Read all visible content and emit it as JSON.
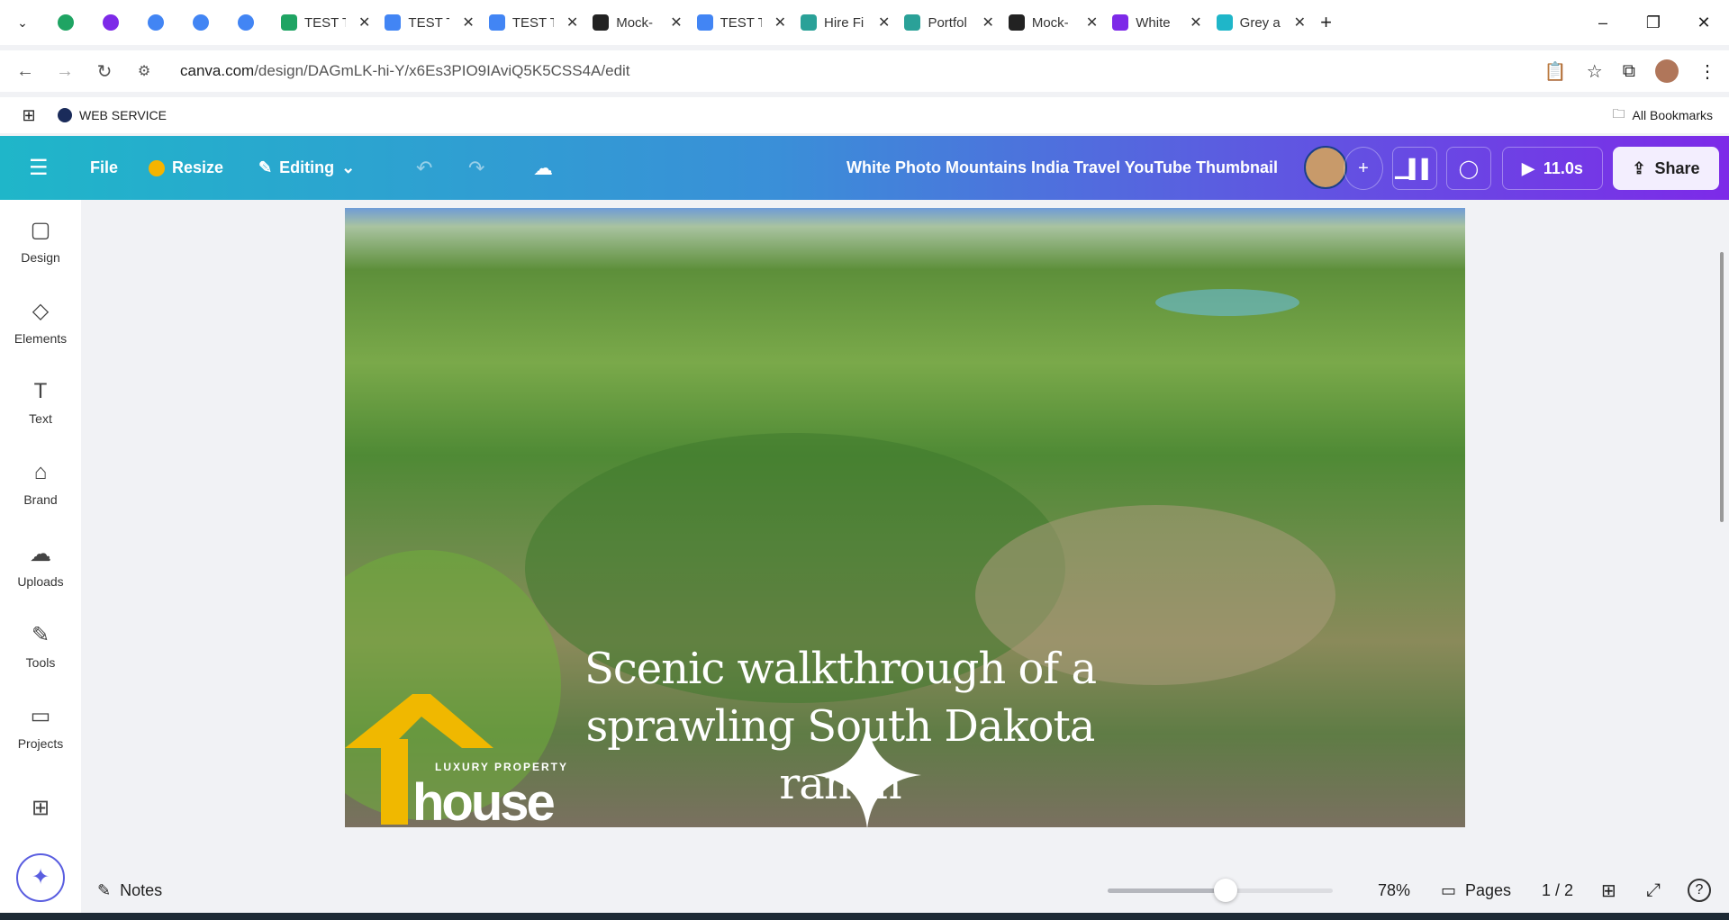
{
  "browser": {
    "tabs": [
      {
        "label": "",
        "color": "#1fa463"
      },
      {
        "label": "",
        "color": "#7d2ae8"
      },
      {
        "label": "",
        "color": "#4285f4"
      },
      {
        "label": "",
        "color": "#4285f4"
      },
      {
        "label": "",
        "color": "#4285f4"
      },
      {
        "label": "TEST T",
        "color": "#1fa463"
      },
      {
        "label": "TEST T",
        "color": "#4285f4"
      },
      {
        "label": "TEST T",
        "color": "#4285f4"
      },
      {
        "label": "Mock-",
        "color": "#222"
      },
      {
        "label": "TEST T",
        "color": "#4285f4"
      },
      {
        "label": "Hire Fi",
        "color": "#2aa198"
      },
      {
        "label": "Portfol",
        "color": "#2aa198"
      },
      {
        "label": "Mock-",
        "color": "#222"
      },
      {
        "label": "White",
        "color": "#7d2ae8"
      },
      {
        "label": "Grey a",
        "color": "#1fb6c9"
      }
    ],
    "url_host": "canva.com",
    "url_path": "/design/DAGmLK-hi-Y/x6Es3PIO9IAviQ5K5CSS4A/edit",
    "bookmark": "WEB SERVICE",
    "all_bookmarks": "All Bookmarks"
  },
  "toolbar": {
    "file": "File",
    "resize": "Resize",
    "editing": "Editing",
    "title": "White Photo Mountains India Travel YouTube Thumbnail",
    "duration": "11.0s",
    "share": "Share"
  },
  "sidebar": [
    {
      "label": "Design",
      "icon": "▢"
    },
    {
      "label": "Elements",
      "icon": "◇"
    },
    {
      "label": "Text",
      "icon": "T"
    },
    {
      "label": "Brand",
      "icon": "⌂"
    },
    {
      "label": "Uploads",
      "icon": "☁"
    },
    {
      "label": "Tools",
      "icon": "✎"
    },
    {
      "label": "Projects",
      "icon": "▭"
    },
    {
      "label": "",
      "icon": "⊞"
    }
  ],
  "design": {
    "caption": "Scenic walkthrough of a sprawling South Dakota ranch",
    "logo_tag": "LUXURY PROPERTY",
    "logo_word": "house"
  },
  "footer": {
    "notes": "Notes",
    "zoom": "78%",
    "zoom_value": 78,
    "pages": "Pages",
    "page_indicator": "1 / 2"
  }
}
